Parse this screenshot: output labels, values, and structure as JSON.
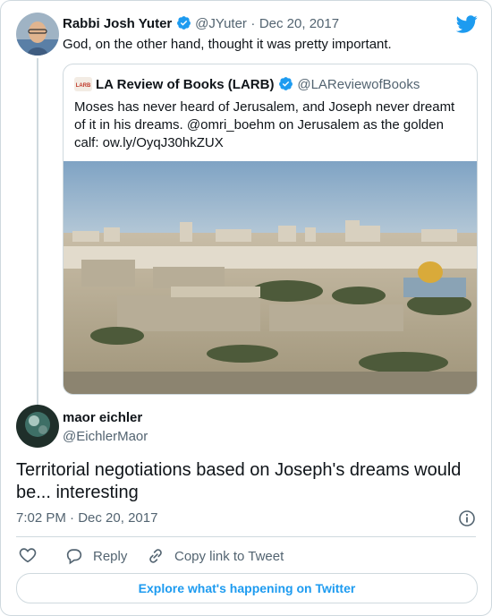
{
  "tweet": {
    "author_name": "Rabbi Josh Yuter",
    "author_handle": "@JYuter",
    "separator": "·",
    "date": "Dec 20, 2017",
    "text": "God, on the other hand, thought it was pretty important."
  },
  "quoted": {
    "author_name": "LA Review of Books (LARB)",
    "author_handle": "@LAReviewofBooks",
    "logo_text": "LARB",
    "text": "Moses has never heard of Jerusalem, and Joseph never dreamt of it in his dreams. @omri_boehm on Jerusalem as the golden calf: ow.ly/OyqJ30hkZUX"
  },
  "reply": {
    "author_name": "maor eichler",
    "author_handle": "@EichlerMaor",
    "text": "Territorial negotiations based on Joseph's dreams would be... interesting",
    "time": "7:02 PM",
    "separator": "·",
    "date": "Dec 20, 2017"
  },
  "actions": {
    "reply_label": "Reply",
    "copy_label": "Copy link to Tweet"
  },
  "explore_label": "Explore what's happening on Twitter",
  "icons": {
    "brand": "twitter-bird-icon",
    "verified": "verified-badge-icon",
    "info": "info-icon",
    "like": "heart-icon",
    "reply": "reply-bubble-icon",
    "copy": "link-icon"
  },
  "colors": {
    "accent": "#1d9bf0",
    "text": "#0f1419",
    "muted": "#536471",
    "border": "#cfd9de"
  }
}
